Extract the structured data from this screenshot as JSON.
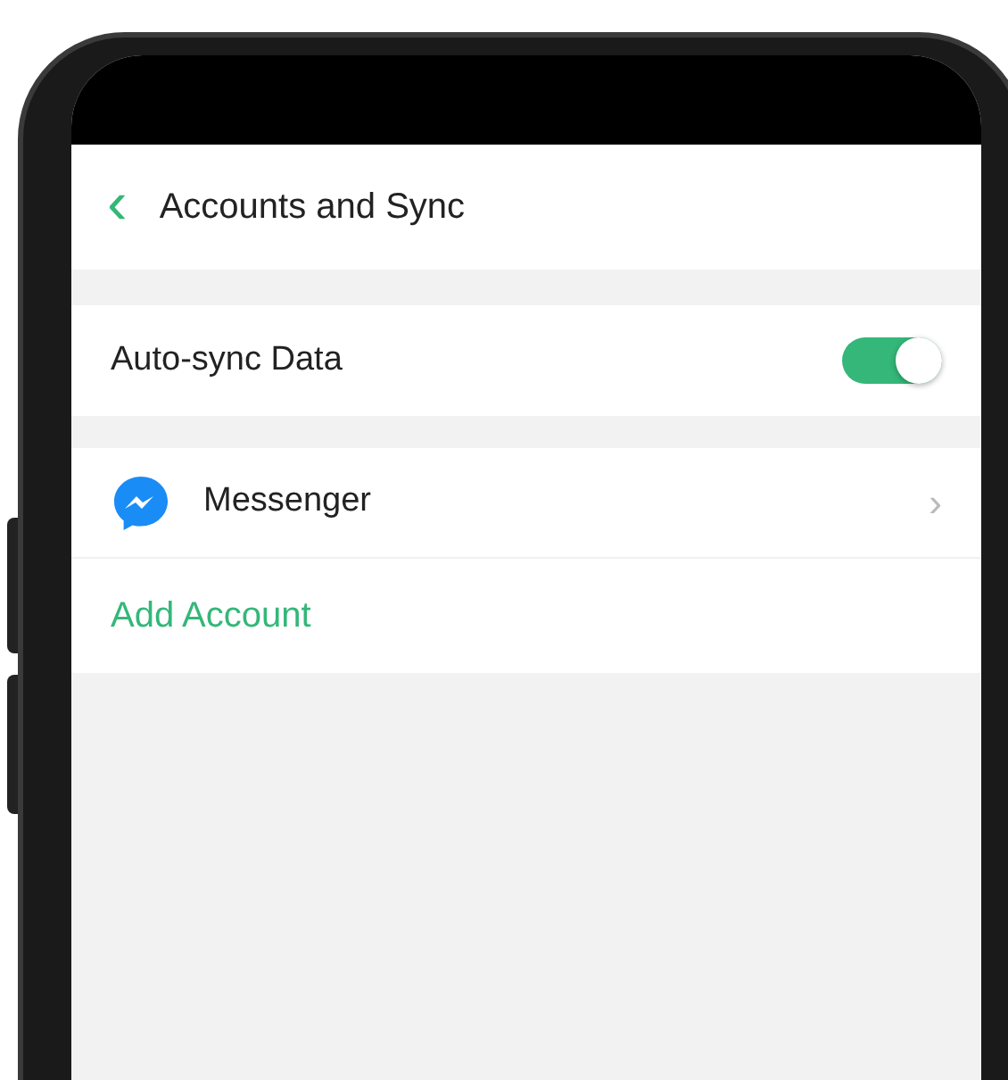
{
  "header": {
    "back_glyph": "‹",
    "title": "Accounts and Sync"
  },
  "settings": [
    {
      "kind": "toggle",
      "label": "Auto-sync Data",
      "on": true
    }
  ],
  "accounts": [
    {
      "name": "Messenger",
      "chevron": "›"
    }
  ],
  "add_account": "Add Account"
}
